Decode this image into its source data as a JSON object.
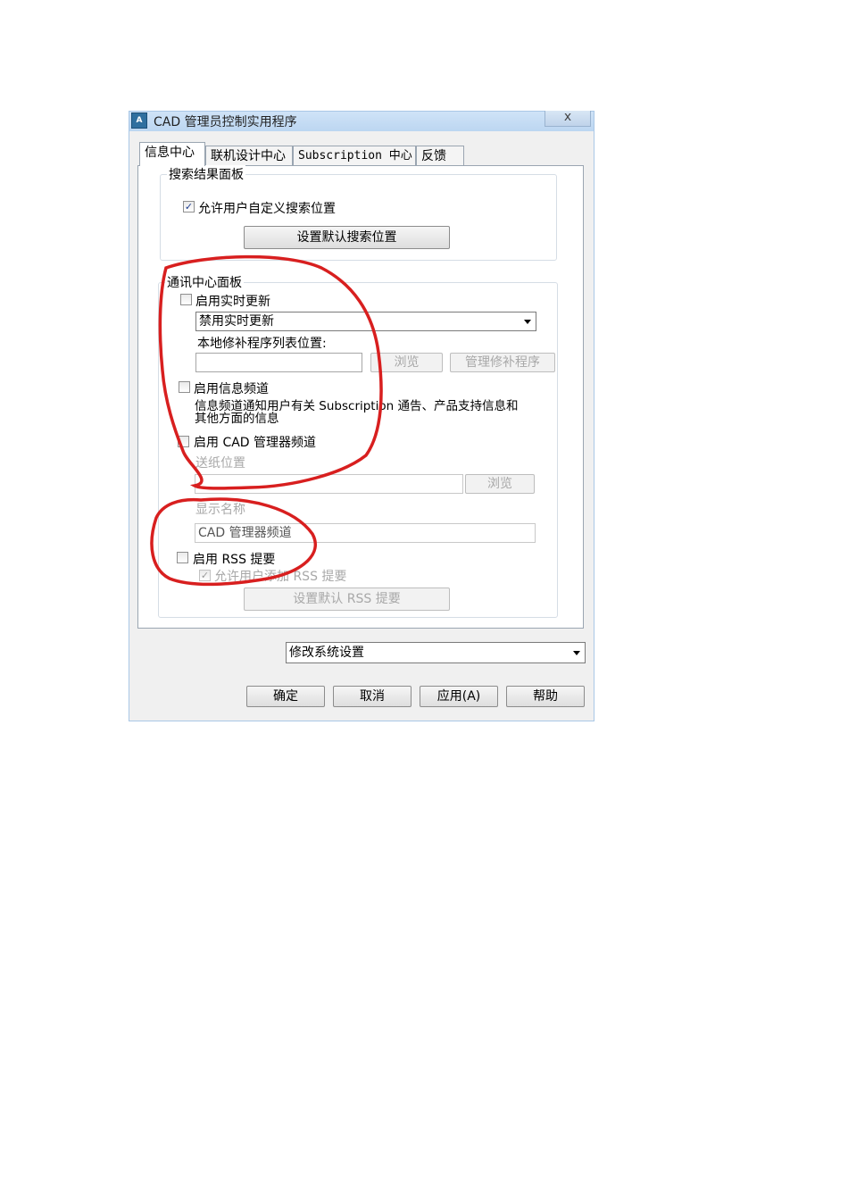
{
  "window": {
    "title": "CAD 管理员控制实用程序",
    "icon": "app-icon",
    "close_label": "x"
  },
  "tabs": [
    {
      "label": "信息中心",
      "active": true
    },
    {
      "label": "联机设计中心",
      "active": false
    },
    {
      "label": "Subscription 中心",
      "active": false
    },
    {
      "label": "反馈",
      "active": false
    }
  ],
  "search_panel": {
    "legend": "搜索结果面板",
    "allow_custom_location_label": "允许用户自定义搜索位置",
    "allow_custom_location_checked": true,
    "set_default_button": "设置默认搜索位置"
  },
  "comm_panel": {
    "legend": "通讯中心面板",
    "realtime_update_label": "启用实时更新",
    "realtime_update_checked": false,
    "realtime_select_value": "禁用实时更新",
    "patch_list_label": "本地修补程序列表位置:",
    "patch_list_value": "",
    "browse_button": "浏览",
    "manage_patches_button": "管理修补程序",
    "info_channel_label": "启用信息频道",
    "info_channel_checked": false,
    "info_channel_desc_line1": "信息频道通知用户有关 Subscription 通告、产品支持信息和",
    "info_channel_desc_line2": "其他方面的信息",
    "cad_channel_label": "启用 CAD 管理器频道",
    "cad_channel_checked": false,
    "feed_location_label": "送纸位置",
    "feed_location_value": "",
    "feed_browse_button": "浏览",
    "display_name_label": "显示名称",
    "display_name_value": "CAD 管理器频道",
    "rss_label": "启用 RSS 提要",
    "rss_checked": false,
    "allow_rss_label": "允许用户添加 RSS 提要",
    "allow_rss_checked": true,
    "set_default_rss_button": "设置默认 RSS 提要"
  },
  "system_settings_select": "修改系统设置",
  "footer_buttons": {
    "ok": "确定",
    "cancel": "取消",
    "apply": "应用(A)",
    "help": "帮助"
  },
  "colors": {
    "annotation_red": "#d81f1f",
    "titlebar": "#c6ddf4",
    "dialog_bg": "#f0f0f0"
  }
}
